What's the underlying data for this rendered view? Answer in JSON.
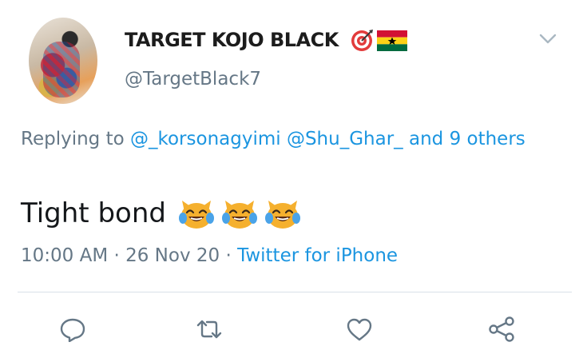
{
  "header": {
    "display_name": "TARGET KOJO BLACK",
    "handle": "@TargetBlack7",
    "name_icons": [
      "target-emoji",
      "ghana-flag-emoji"
    ]
  },
  "reply_context": {
    "prefix": "Replying to",
    "mention_1": "@_korsonagyimi",
    "mention_2": "@Shu_Ghar_",
    "suffix": "and 9 others"
  },
  "tweet": {
    "text": "Tight bond",
    "emojis": [
      "cat-tears-of-joy-emoji",
      "cat-tears-of-joy-emoji",
      "cat-tears-of-joy-emoji"
    ]
  },
  "meta": {
    "time": "10:00 AM",
    "sep1": " · ",
    "date": "26 Nov 20",
    "sep2": " · ",
    "source": "Twitter for iPhone"
  },
  "actions": [
    "reply-icon",
    "retweet-icon",
    "like-icon",
    "share-icon"
  ],
  "colors": {
    "link": "#1b95e0",
    "muted": "#657786",
    "text": "#14171a",
    "divider": "#d9e1e8",
    "icon": "#657786"
  }
}
